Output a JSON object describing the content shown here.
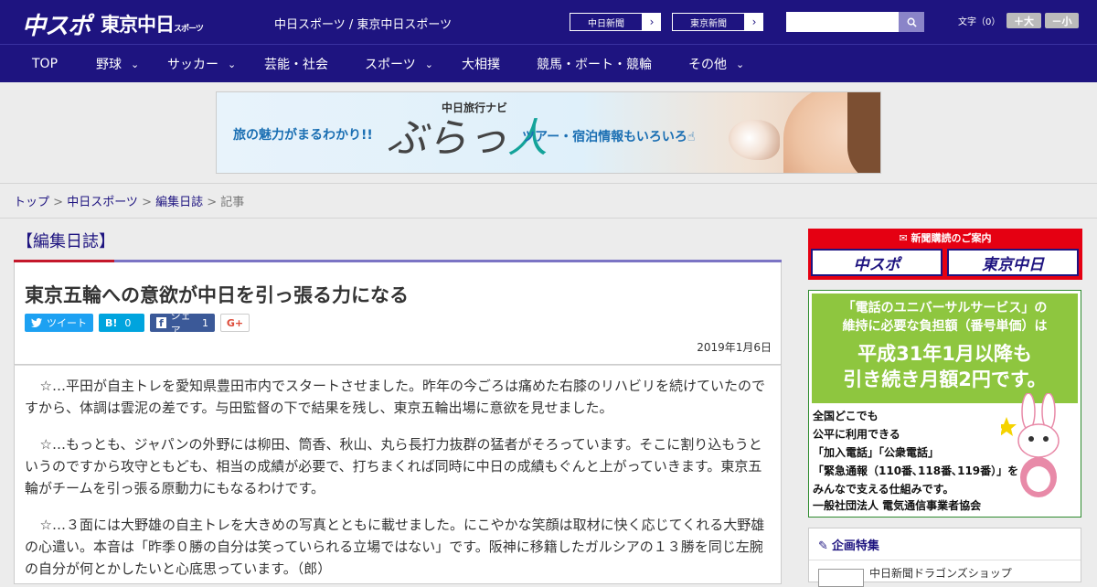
{
  "header": {
    "logo_chuspo": "中スポ",
    "logo_tokyo": "東京中日",
    "logo_tokyo_small": "スポーツ",
    "site_title": "中日スポーツ / 東京中日スポーツ",
    "btn_chunichi": "中日新聞",
    "btn_tokyo": "東京新聞",
    "arrow": "›",
    "search_placeholder": "",
    "search_icon": "magnifier-icon",
    "fontsize_label": "文字（0）",
    "font_plus": "＋大",
    "font_minus": "－小"
  },
  "nav": {
    "items": [
      "TOP",
      "野球",
      "サッカー",
      "芸能・社会",
      "スポーツ",
      "大相撲",
      "競馬・ボート・競輪",
      "その他"
    ],
    "chevron": "⌄"
  },
  "banner": {
    "tagline_left": "旅の魅力がまるわかり!!",
    "brand_small": "中日旅行ナビ",
    "brand_big_a": "ぶらっ",
    "brand_big_b": "人",
    "tagline_right": "ツアー・宿泊情報もいろいろ☝"
  },
  "breadcrumb": {
    "top": "トップ",
    "sep": " > ",
    "chuspo": "中日スポーツ",
    "category": "編集日誌",
    "current": "記事"
  },
  "article": {
    "category_label": "【編集日誌】",
    "headline": "東京五輪への意欲が中日を引っ張る力になる",
    "tweet": "ツイート",
    "hatena_label": "B!",
    "hatena_count": "0",
    "share_label": "シェア",
    "share_count": "1",
    "gplus": "G+",
    "date": "2019年1月6日",
    "paragraphs": [
      "☆…平田が自主トレを愛知県豊田市内でスタートさせました。昨年の今ごろは痛めた右膝のリハビリを続けていたのですから、体調は雲泥の差です。与田監督の下で結果を残し、東京五輪出場に意欲を見せました。",
      "☆…もっとも、ジャパンの外野には柳田、筒香、秋山、丸ら長打力抜群の猛者がそろっています。そこに割り込もうというのですから攻守ともども、相当の成績が必要で、打ちまくれば同時に中日の成績もぐんと上がっていきます。東京五輪がチームを引っ張る原動力にもなるわけです。",
      "☆…３面には大野雄の自主トレを大きめの写真とともに載せました。にこやかな笑顔は取材に快く応じてくれる大野雄の心遣い。本音は「昨季０勝の自分は笑っていられる立場ではない」です。阪神に移籍したガルシアの１３勝を同じ左腕の自分が何とかしたいと心底思っています。（郎）"
    ]
  },
  "sidebar": {
    "subscribe_title": "新聞購読のご案内",
    "subscribe_chuspo": "中スポ",
    "subscribe_tokyo": "東京中日",
    "uni_line1": "「電話のユニバーサルサービス」の",
    "uni_line2": "維持に必要な負担額（番号単価）は",
    "uni_big1": "平成31年1月以降も",
    "uni_big2": "引き続き月額2円です。",
    "uni_t1": "全国どこでも",
    "uni_t2": "公平に利用できる",
    "uni_t3": "「加入電話」「公衆電話」",
    "uni_t4": "「緊急通報（110番､118番､119番）」を",
    "uni_t5": "みんなで支える仕組みです。",
    "uni_foot": "一般社団法人 電気通信事業者協会",
    "feature_title": "企画特集",
    "feature_sub": "中日新聞ドラゴンズショップ"
  },
  "colors": {
    "brand_navy": "#1e1480",
    "accent_red": "#c4182b",
    "twitter": "#1da1f2",
    "hatena": "#00a4de",
    "facebook": "#3b5998"
  }
}
